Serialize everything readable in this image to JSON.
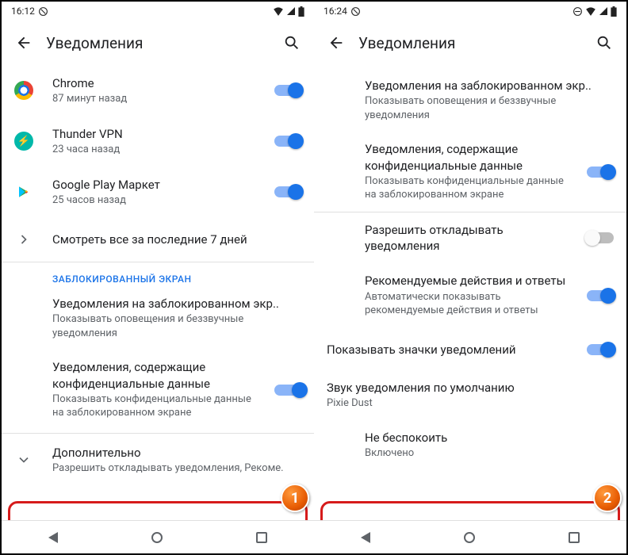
{
  "left": {
    "statusbar": {
      "time": "16:12"
    },
    "appbar": {
      "title": "Уведомления"
    },
    "apps": [
      {
        "name": "Chrome",
        "sub": "87 минут назад",
        "iconClass": "chrome-icon"
      },
      {
        "name": "Thunder VPN",
        "sub": "23 часа назад",
        "iconClass": "thunder-icon"
      },
      {
        "name": "Google Play Маркет",
        "sub": "25 часов назад",
        "iconClass": "play-icon"
      }
    ],
    "seeAll": "Смотреть все за последние 7 дней",
    "sectionHeader": "ЗАБЛОКИРОВАННЫЙ ЭКРАН",
    "lockNotif": {
      "title": "Уведомления на заблокированном экр..",
      "sub": "Показывать оповещения и беззвучные уведомления"
    },
    "sensitive": {
      "title": "Уведомления, содержащие конфиденциальные данные",
      "sub": "Показывать конфиденциальные данные на заблокированном экране"
    },
    "advanced": {
      "title": "Дополнительно",
      "sub": "Разрешить откладывать уведомления, Рекоме."
    },
    "step": "1"
  },
  "right": {
    "statusbar": {
      "time": "16:24"
    },
    "appbar": {
      "title": "Уведомления"
    },
    "lockNotif": {
      "title": "Уведомления на заблокированном экр..",
      "sub": "Показывать оповещения и беззвучные уведомления"
    },
    "sensitive": {
      "title": "Уведомления, содержащие конфиденциальные данные",
      "sub": "Показывать конфиденциальные данные на заблокированном экране"
    },
    "snooze": {
      "title": "Разрешить откладывать уведомления"
    },
    "suggested": {
      "title": "Рекомендуемые действия и ответы",
      "sub": "Автоматически показывать рекомендуемые действия и ответы"
    },
    "badges": {
      "title": "Показывать значки уведомлений"
    },
    "sound": {
      "title": "Звук уведомления по умолчанию",
      "sub": "Pixie Dust"
    },
    "dnd": {
      "title": "Не беспокоить",
      "sub": "Включено"
    },
    "step": "2"
  }
}
